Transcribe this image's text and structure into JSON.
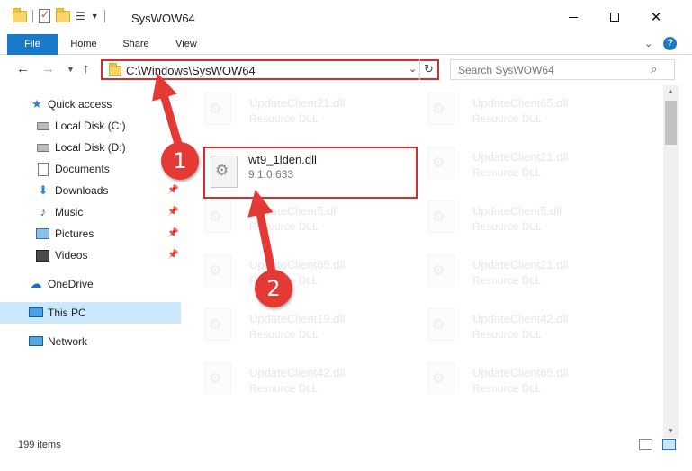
{
  "window": {
    "title": "SysWOW64",
    "minimize_label": "",
    "maximize_label": "",
    "close_label": "✕"
  },
  "ribbon": {
    "tabs": [
      "File",
      "Home",
      "Share",
      "View"
    ],
    "help": "?"
  },
  "address": {
    "path": "C:\\Windows\\SysWOW64"
  },
  "search": {
    "placeholder": "Search SysWOW64"
  },
  "sidebar": {
    "items": [
      {
        "label": "Quick access",
        "icon": "star-icon",
        "pinned": false
      },
      {
        "label": "Local Disk (C:)",
        "icon": "disk-icon",
        "pinned": false
      },
      {
        "label": "Local Disk (D:)",
        "icon": "disk-icon",
        "pinned": false
      },
      {
        "label": "Documents",
        "icon": "documents-icon",
        "pinned": false
      },
      {
        "label": "Downloads",
        "icon": "download-icon",
        "pinned": true
      },
      {
        "label": "Music",
        "icon": "music-icon",
        "pinned": true
      },
      {
        "label": "Pictures",
        "icon": "pictures-icon",
        "pinned": true
      },
      {
        "label": "Videos",
        "icon": "videos-icon",
        "pinned": true
      },
      {
        "label": "OneDrive",
        "icon": "cloud-icon",
        "pinned": false
      },
      {
        "label": "This PC",
        "icon": "computer-icon",
        "pinned": false,
        "selected": true
      },
      {
        "label": "Network",
        "icon": "network-icon",
        "pinned": false
      }
    ]
  },
  "files": {
    "highlighted": {
      "name": "wt9_1lden.dll",
      "detail": "9.1.0.633"
    },
    "left_column": [
      {
        "name": "UpdateClient21.dll",
        "detail": "Resource DLL"
      },
      {
        "name": "UpdateClient5.dll",
        "detail": "Resource DLL"
      },
      {
        "name": "UpdateClient65.dll",
        "detail": "Resource DLL"
      },
      {
        "name": "UpdateClient19.dll",
        "detail": "Resource DLL"
      },
      {
        "name": "UpdateClient42.dll",
        "detail": "Resource DLL"
      }
    ],
    "right_column": [
      {
        "name": "UpdateClient65.dll",
        "detail": "Resource DLL"
      },
      {
        "name": "UpdateClient21.dll",
        "detail": "Resource DLL"
      },
      {
        "name": "UpdateClient5.dll",
        "detail": "Resource DLL"
      },
      {
        "name": "UpdateClient21.dll",
        "detail": "Resource DLL"
      },
      {
        "name": "UpdateClient42.dll",
        "detail": "Resource DLL"
      },
      {
        "name": "UpdateClient65.dll",
        "detail": "Resource DLL"
      }
    ]
  },
  "status": {
    "item_count": "199 items"
  },
  "annotations": {
    "step1": "1",
    "step2": "2",
    "color": "#e53935"
  }
}
